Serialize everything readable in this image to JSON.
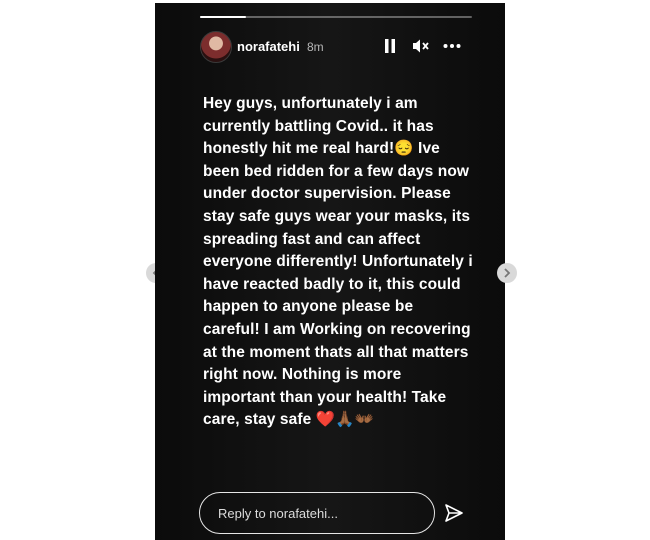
{
  "story": {
    "username": "norafatehi",
    "timestamp": "8m",
    "progress": 0.17,
    "text": "Hey guys, unfortunately i am currently battling Covid.. it has honestly hit me real hard!",
    "emoji_sad": "😔",
    "text_2": " Ive been bed ridden for a few days now under doctor supervision. Please stay safe guys wear your masks, its spreading fast and can affect everyone differently! Unfortunately i have reacted badly to it, this could happen to anyone please be careful! I am Working on recovering at the moment thats all that matters right now. Nothing is more important than your health! Take care, stay safe ",
    "emoji_end": "❤️🙏🏾👐🏾"
  },
  "reply": {
    "placeholder": "Reply to norafatehi..."
  },
  "icons": {
    "pause": "pause-icon",
    "mute": "speaker-muted-icon",
    "more": "more-horizontal-icon",
    "send": "paper-plane-icon",
    "prev": "chevron-left-icon",
    "next": "chevron-right-icon"
  },
  "colors": {
    "background": "#111111",
    "text": "#ffffff",
    "secondary_text": "#b8b8b8"
  }
}
